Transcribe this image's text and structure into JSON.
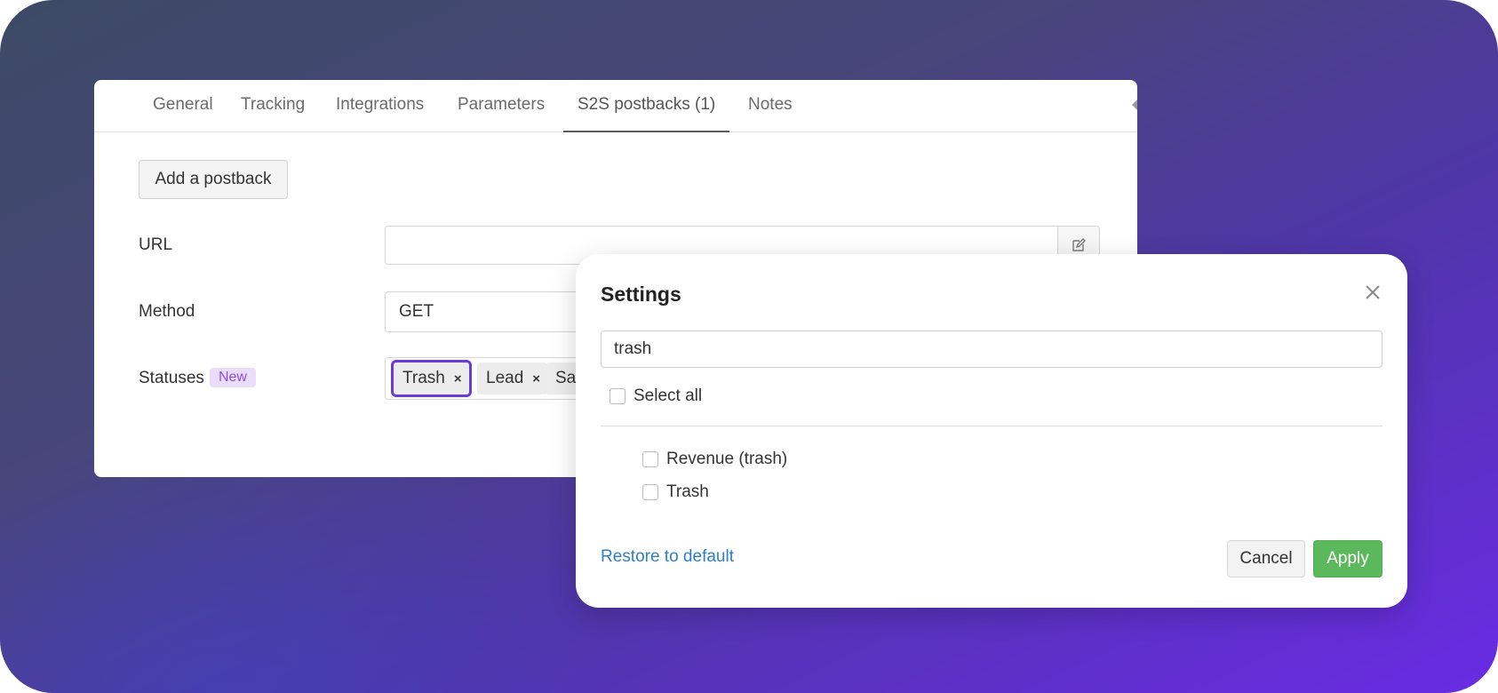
{
  "tabs": [
    {
      "label": "General"
    },
    {
      "label": "Tracking"
    },
    {
      "label": "Integrations"
    },
    {
      "label": "Parameters"
    },
    {
      "label": "S2S postbacks (1)"
    },
    {
      "label": "Notes"
    }
  ],
  "active_tab": "S2S postbacks (1)",
  "form": {
    "add_button": "Add a postback",
    "url_label": "URL",
    "url_value": "",
    "method_label": "Method",
    "method_value": "GET",
    "statuses_label": "Statuses",
    "statuses_badge": "New",
    "status_chips": [
      "Trash",
      "Lead",
      "Sa"
    ],
    "chip_remove": "×"
  },
  "modal": {
    "title": "Settings",
    "search_value": "trash",
    "select_all": "Select all",
    "options": [
      "Revenue (trash)",
      "Trash"
    ],
    "restore": "Restore to default",
    "cancel": "Cancel",
    "apply": "Apply"
  },
  "colors": {
    "accent_purple": "#6b3bd3",
    "link_blue": "#2f7ec2",
    "apply_green": "#5cb85c"
  }
}
